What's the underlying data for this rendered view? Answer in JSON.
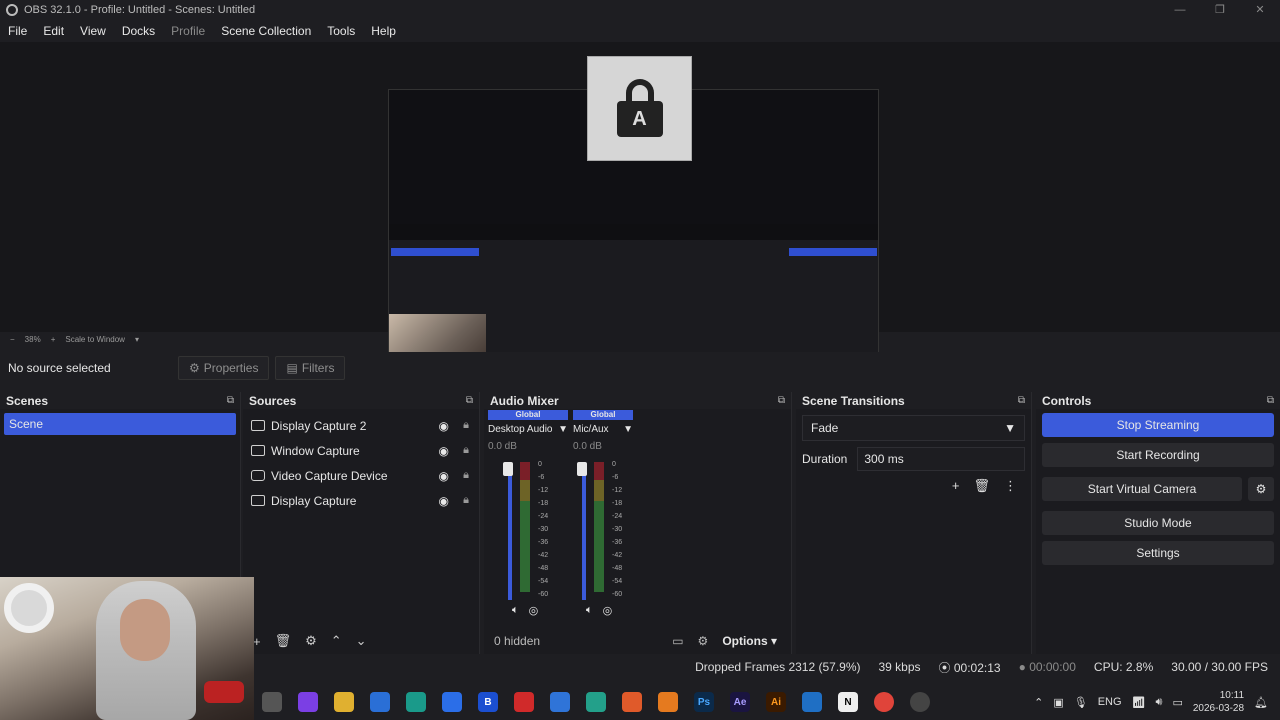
{
  "window": {
    "title": "OBS 32.1.0 - Profile: Untitled - Scenes: Untitled",
    "minimize": "—",
    "maximize": "❐",
    "close": "✕"
  },
  "menu": {
    "file": "File",
    "edit": "Edit",
    "view": "View",
    "docks": "Docks",
    "profile": "Profile",
    "scene_collection": "Scene Collection",
    "tools": "Tools",
    "help": "Help"
  },
  "zoombar": {
    "zoom": "38%",
    "mode": "Scale to Window"
  },
  "source_toolbar": {
    "no_source": "No source selected",
    "properties": "Properties",
    "filters": "Filters"
  },
  "scenes": {
    "title": "Scenes",
    "items": [
      "Scene"
    ]
  },
  "sources": {
    "title": "Sources",
    "items": [
      "Display Capture 2",
      "Window Capture",
      "Video Capture Device",
      "Display Capture"
    ]
  },
  "mixer": {
    "title": "Audio Mixer",
    "channels": [
      {
        "global": "Global",
        "name": "Desktop Audio",
        "db": "0.0 dB"
      },
      {
        "global": "Global",
        "name": "Mic/Aux",
        "db": "0.0 dB"
      }
    ],
    "scale": [
      "0",
      "-6",
      "-12",
      "-18",
      "-24",
      "-30",
      "-36",
      "-42",
      "-48",
      "-54",
      "-60"
    ],
    "hidden": "0 hidden",
    "options": "Options"
  },
  "transitions": {
    "title": "Scene Transitions",
    "selected": "Fade",
    "duration_label": "Duration",
    "duration_value": "300 ms"
  },
  "controls": {
    "title": "Controls",
    "stop_streaming": "Stop Streaming",
    "start_recording": "Start Recording",
    "start_virtual_camera": "Start Virtual Camera",
    "studio_mode": "Studio Mode",
    "settings": "Settings"
  },
  "status": {
    "dropped": "Dropped Frames 2312 (57.9%)",
    "bitrate": "39 kbps",
    "stream_time": "00:02:13",
    "rec_time": "00:00:00",
    "cpu": "CPU: 2.8%",
    "fps": "30.00 / 30.00 FPS"
  },
  "tray": {
    "lang": "ENG",
    "time": "10:11",
    "date": "2026-03-28"
  },
  "colors": {
    "accent": "#3b5bdb",
    "bg": "#1e1e22"
  }
}
